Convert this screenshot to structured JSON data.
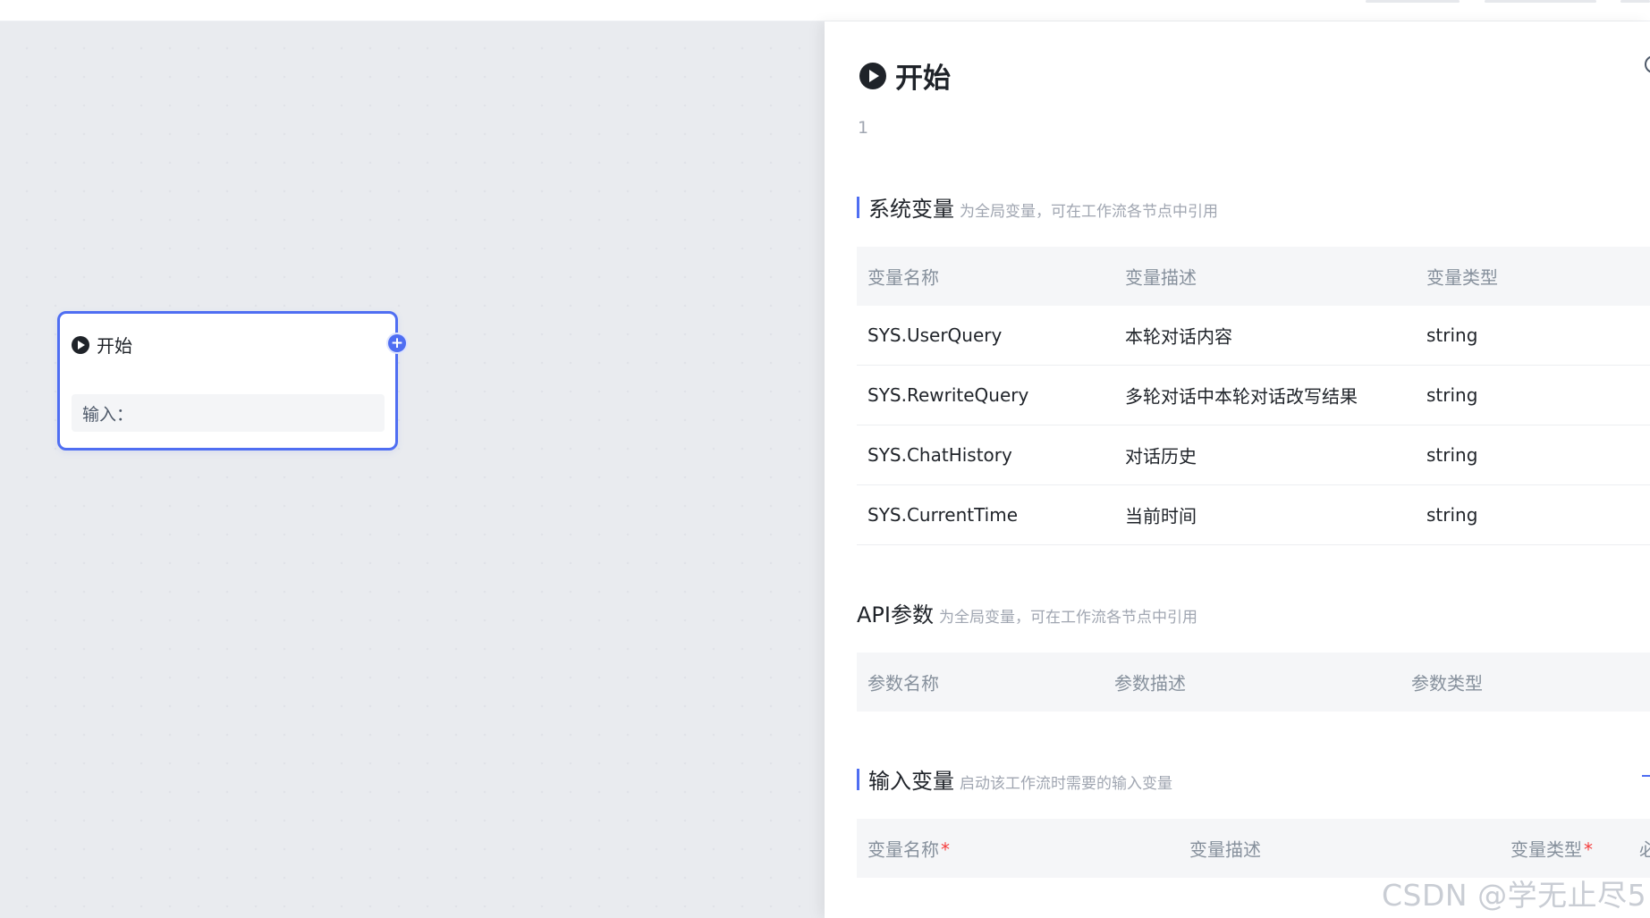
{
  "canvas": {
    "node": {
      "title": "开始",
      "input_label": "输入："
    }
  },
  "panel": {
    "title": "开始",
    "description": "1",
    "system_vars": {
      "title": "系统变量",
      "subtitle": "为全局变量，可在工作流各节点中引用",
      "headers": [
        "变量名称",
        "变量描述",
        "变量类型"
      ],
      "rows": [
        [
          "SYS.UserQuery",
          "本轮对话内容",
          "string"
        ],
        [
          "SYS.RewriteQuery",
          "多轮对话中本轮对话改写结果",
          "string"
        ],
        [
          "SYS.ChatHistory",
          "对话历史",
          "string"
        ],
        [
          "SYS.CurrentTime",
          "当前时间",
          "string"
        ]
      ]
    },
    "api_params": {
      "title": "API参数",
      "subtitle": "为全局变量，可在工作流各节点中引用",
      "headers": [
        "参数名称",
        "参数描述",
        "参数类型"
      ]
    },
    "input_vars": {
      "title": "输入变量",
      "subtitle": "启动该工作流时需要的输入变量",
      "headers": [
        "变量名称",
        "变量描述",
        "变量类型",
        "必"
      ],
      "required_mark": "*"
    }
  },
  "watermark": "CSDN @学无止尽5",
  "colors": {
    "accent": "#4f6ef2",
    "table_header_bg": "#f5f6f8",
    "required": "#f53f3f"
  },
  "icons": {
    "node": "play-circle-icon",
    "add_handle": "plus-circle-icon"
  }
}
